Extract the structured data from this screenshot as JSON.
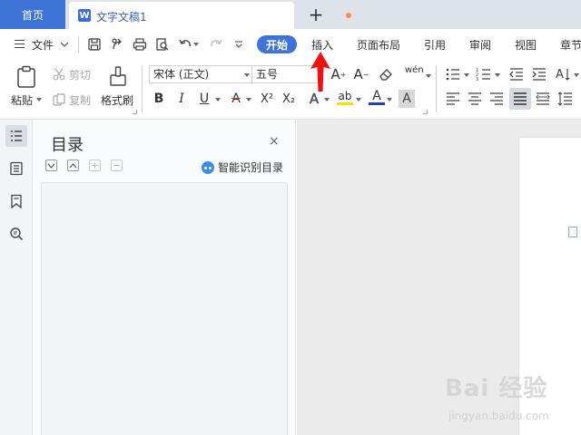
{
  "tabs": {
    "home_label": "首页",
    "document_title": "文字文稿1",
    "doc_icon_letter": "W",
    "add_tab_glyph": "+",
    "unsaved_dot_color": "#f0904a"
  },
  "menu": {
    "file_label": "文件",
    "items": [
      "开始",
      "插入",
      "页面布局",
      "引用",
      "审阅",
      "视图",
      "章节"
    ],
    "active_item": "开始",
    "accent_color": "#3f73d8"
  },
  "ribbon": {
    "clipboard": {
      "paste_label": "粘贴",
      "cut_label": "剪切",
      "copy_label": "复制",
      "format_painter_label": "格式刷"
    },
    "font": {
      "font_name": "宋体 (正文)",
      "font_size": "五号",
      "bold": "B",
      "italic": "I",
      "underline": "U",
      "strikethrough": "A",
      "superscript": "X²",
      "subscript": "X₂",
      "text_effect": "A",
      "highlight": "ab",
      "font_color": "A",
      "char_shading": "A",
      "grow_font": "A",
      "shrink_font": "A",
      "phonetic": "wén"
    }
  },
  "sidebar": {
    "icons": [
      "toc-icon",
      "outline-icon",
      "bookmark-icon",
      "find-icon"
    ],
    "active": "toc-icon"
  },
  "toc_panel": {
    "title": "目录",
    "close_glyph": "×",
    "smart_identify_label": "智能识别目录"
  },
  "watermark": {
    "brand": "Bai 经验",
    "url": "jingyan.baidu.com"
  }
}
